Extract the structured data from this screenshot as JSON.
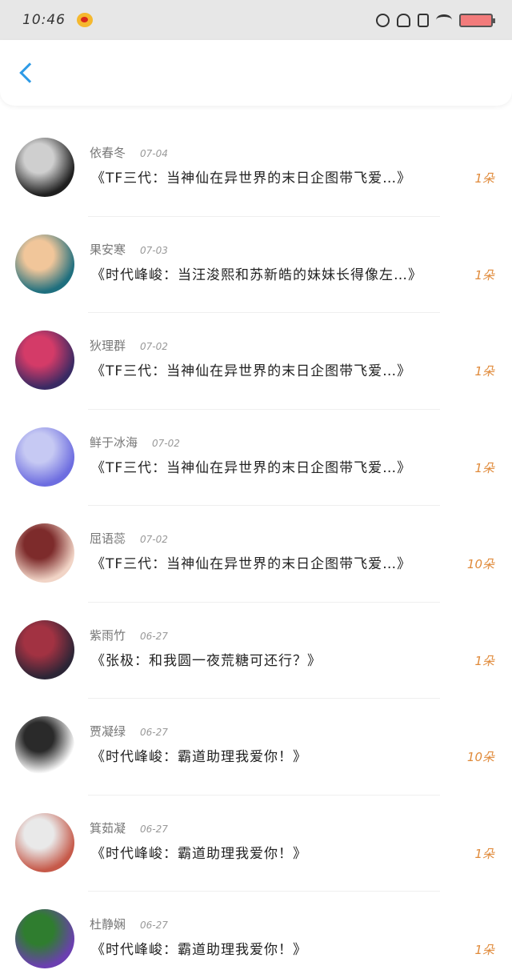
{
  "status_bar": {
    "time": "10:46",
    "app_icon": "weibo-icon",
    "icons": [
      "alarm-icon",
      "mute-bell-icon",
      "sim-icon",
      "wifi-icon",
      "battery-icon"
    ],
    "battery_color": "#f27b7b"
  },
  "nav": {
    "back_icon": "chevron-left-icon",
    "accent": "#2e9be6"
  },
  "items": [
    {
      "name": "依春冬",
      "date": "07-04",
      "title": "《TF三代：当神仙在异世界的末日企图带飞爱…》",
      "count": "1朵",
      "avatar_colors": [
        "#1f1f1f",
        "#cfcfcf"
      ]
    },
    {
      "name": "果安寒",
      "date": "07-03",
      "title": "《时代峰峻：当汪浚熙和苏新皓的妹妹长得像左…》",
      "count": "1朵",
      "avatar_colors": [
        "#1f6f7e",
        "#f1c69a"
      ]
    },
    {
      "name": "狄理群",
      "date": "07-02",
      "title": "《TF三代：当神仙在异世界的末日企图带飞爱…》",
      "count": "1朵",
      "avatar_colors": [
        "#3a2a63",
        "#d43b68"
      ]
    },
    {
      "name": "鲜于冰海",
      "date": "07-02",
      "title": "《TF三代：当神仙在异世界的末日企图带飞爱…》",
      "count": "1朵",
      "avatar_colors": [
        "#6d6de0",
        "#c6c9f3"
      ]
    },
    {
      "name": "屈语蕊",
      "date": "07-02",
      "title": "《TF三代：当神仙在异世界的末日企图带飞爱…》",
      "count": "10朵",
      "avatar_colors": [
        "#f1d4c6",
        "#7d2b2b"
      ]
    },
    {
      "name": "紫雨竹",
      "date": "06-27",
      "title": "《张极：和我圆一夜荒糖可还行？》",
      "count": "1朵",
      "avatar_colors": [
        "#2c2536",
        "#a23242"
      ]
    },
    {
      "name": "贾凝绿",
      "date": "06-27",
      "title": "《时代峰峻：霸道助理我爱你！》",
      "count": "10朵",
      "avatar_colors": [
        "#ffffff",
        "#2a2a2a"
      ]
    },
    {
      "name": "箕茹凝",
      "date": "06-27",
      "title": "《时代峰峻：霸道助理我爱你！》",
      "count": "1朵",
      "avatar_colors": [
        "#c65a4a",
        "#e9e9e9"
      ]
    },
    {
      "name": "杜静娴",
      "date": "06-27",
      "title": "《时代峰峻：霸道助理我爱你！》",
      "count": "1朵",
      "avatar_colors": [
        "#6b3fb0",
        "#2f7d2f"
      ]
    }
  ]
}
